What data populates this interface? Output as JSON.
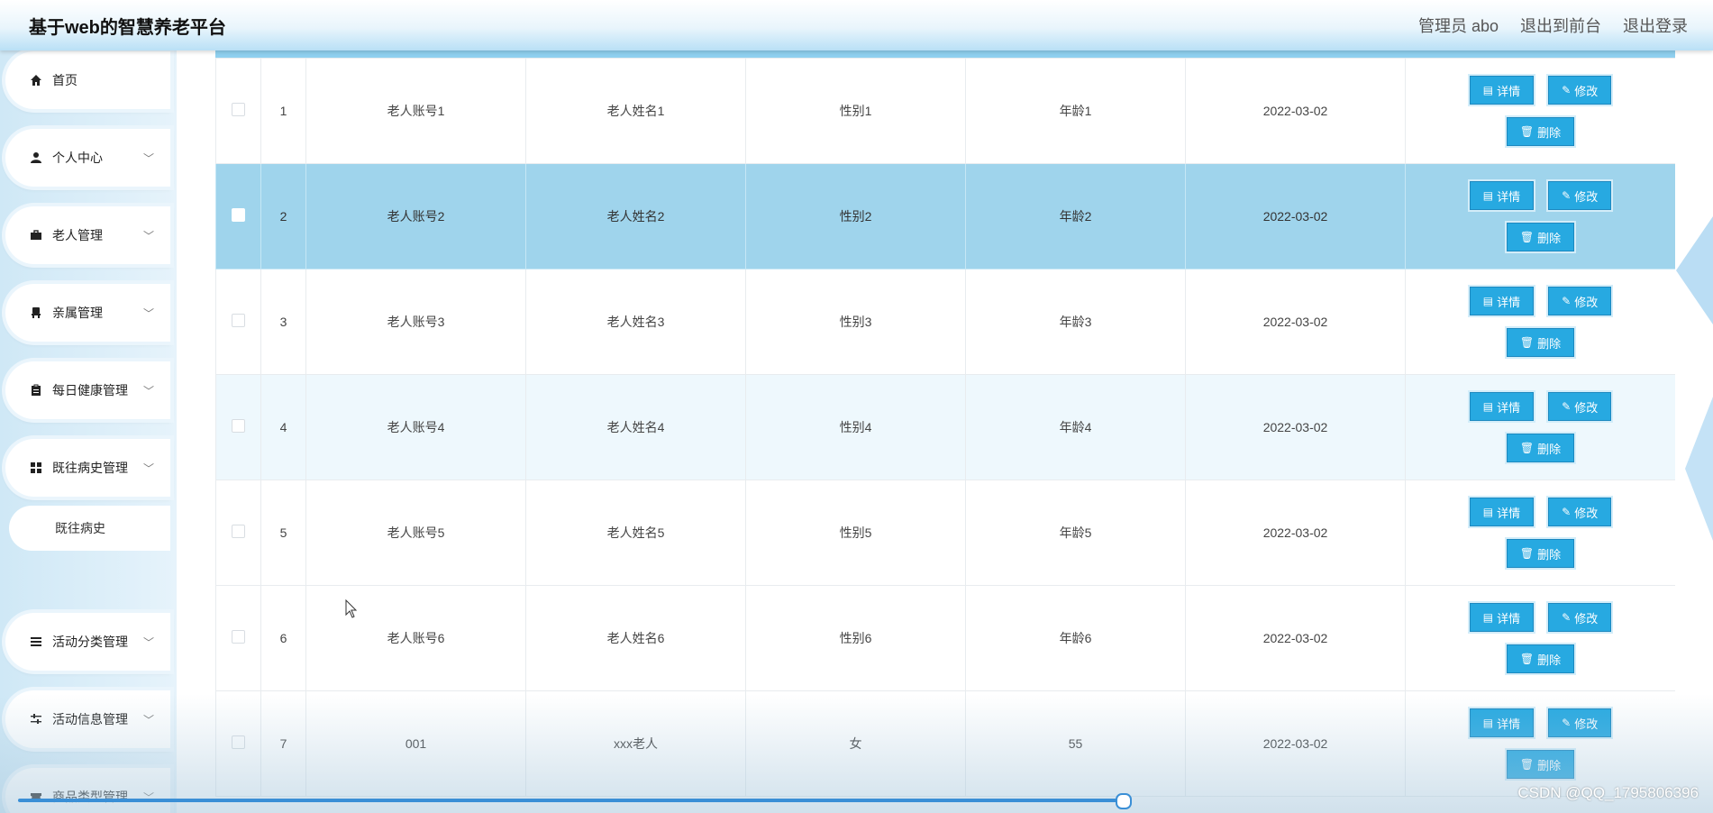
{
  "app": {
    "title": "基于web的智慧养老平台"
  },
  "topnav": {
    "user": "管理员 abo",
    "to_front": "退出到前台",
    "logout": "退出登录"
  },
  "sidebar": {
    "items": [
      {
        "label": "首页",
        "icon": "home-icon",
        "chev": ""
      },
      {
        "label": "个人中心",
        "icon": "user-icon",
        "chev": "﹀"
      },
      {
        "label": "老人管理",
        "icon": "briefcase-icon",
        "chev": "﹀"
      },
      {
        "label": "亲属管理",
        "icon": "chair-icon",
        "chev": "﹀"
      },
      {
        "label": "每日健康管理",
        "icon": "clipboard-icon",
        "chev": "﹀"
      },
      {
        "label": "既往病史管理",
        "icon": "grid-icon",
        "chev": "﹀"
      },
      {
        "label": "活动分类管理",
        "icon": "list-icon",
        "chev": "﹀"
      },
      {
        "label": "活动信息管理",
        "icon": "sliders-icon",
        "chev": "﹀"
      },
      {
        "label": "商品类型管理",
        "icon": "ticket-icon",
        "chev": "﹀"
      }
    ],
    "subitem": "既往病史"
  },
  "table": {
    "buttons": {
      "detail": "详情",
      "edit": "修改",
      "delete": "删除"
    },
    "rows": [
      {
        "index": "1",
        "account": "老人账号1",
        "name": "老人姓名1",
        "gender": "性别1",
        "age": "年龄1",
        "date": "2022-03-02"
      },
      {
        "index": "2",
        "account": "老人账号2",
        "name": "老人姓名2",
        "gender": "性别2",
        "age": "年龄2",
        "date": "2022-03-02"
      },
      {
        "index": "3",
        "account": "老人账号3",
        "name": "老人姓名3",
        "gender": "性别3",
        "age": "年龄3",
        "date": "2022-03-02"
      },
      {
        "index": "4",
        "account": "老人账号4",
        "name": "老人姓名4",
        "gender": "性别4",
        "age": "年龄4",
        "date": "2022-03-02"
      },
      {
        "index": "5",
        "account": "老人账号5",
        "name": "老人姓名5",
        "gender": "性别5",
        "age": "年龄5",
        "date": "2022-03-02"
      },
      {
        "index": "6",
        "account": "老人账号6",
        "name": "老人姓名6",
        "gender": "性别6",
        "age": "年龄6",
        "date": "2022-03-02"
      },
      {
        "index": "7",
        "account": "001",
        "name": "xxx老人",
        "gender": "女",
        "age": "55",
        "date": "2022-03-02"
      }
    ],
    "selected_row": 2,
    "striped_row": 4
  },
  "watermark": "CSDN @QQ_1795806396",
  "colors": {
    "accent": "#27a9e1",
    "selected_row": "#9fd4ec",
    "header_strip": "#8fd0ef"
  }
}
